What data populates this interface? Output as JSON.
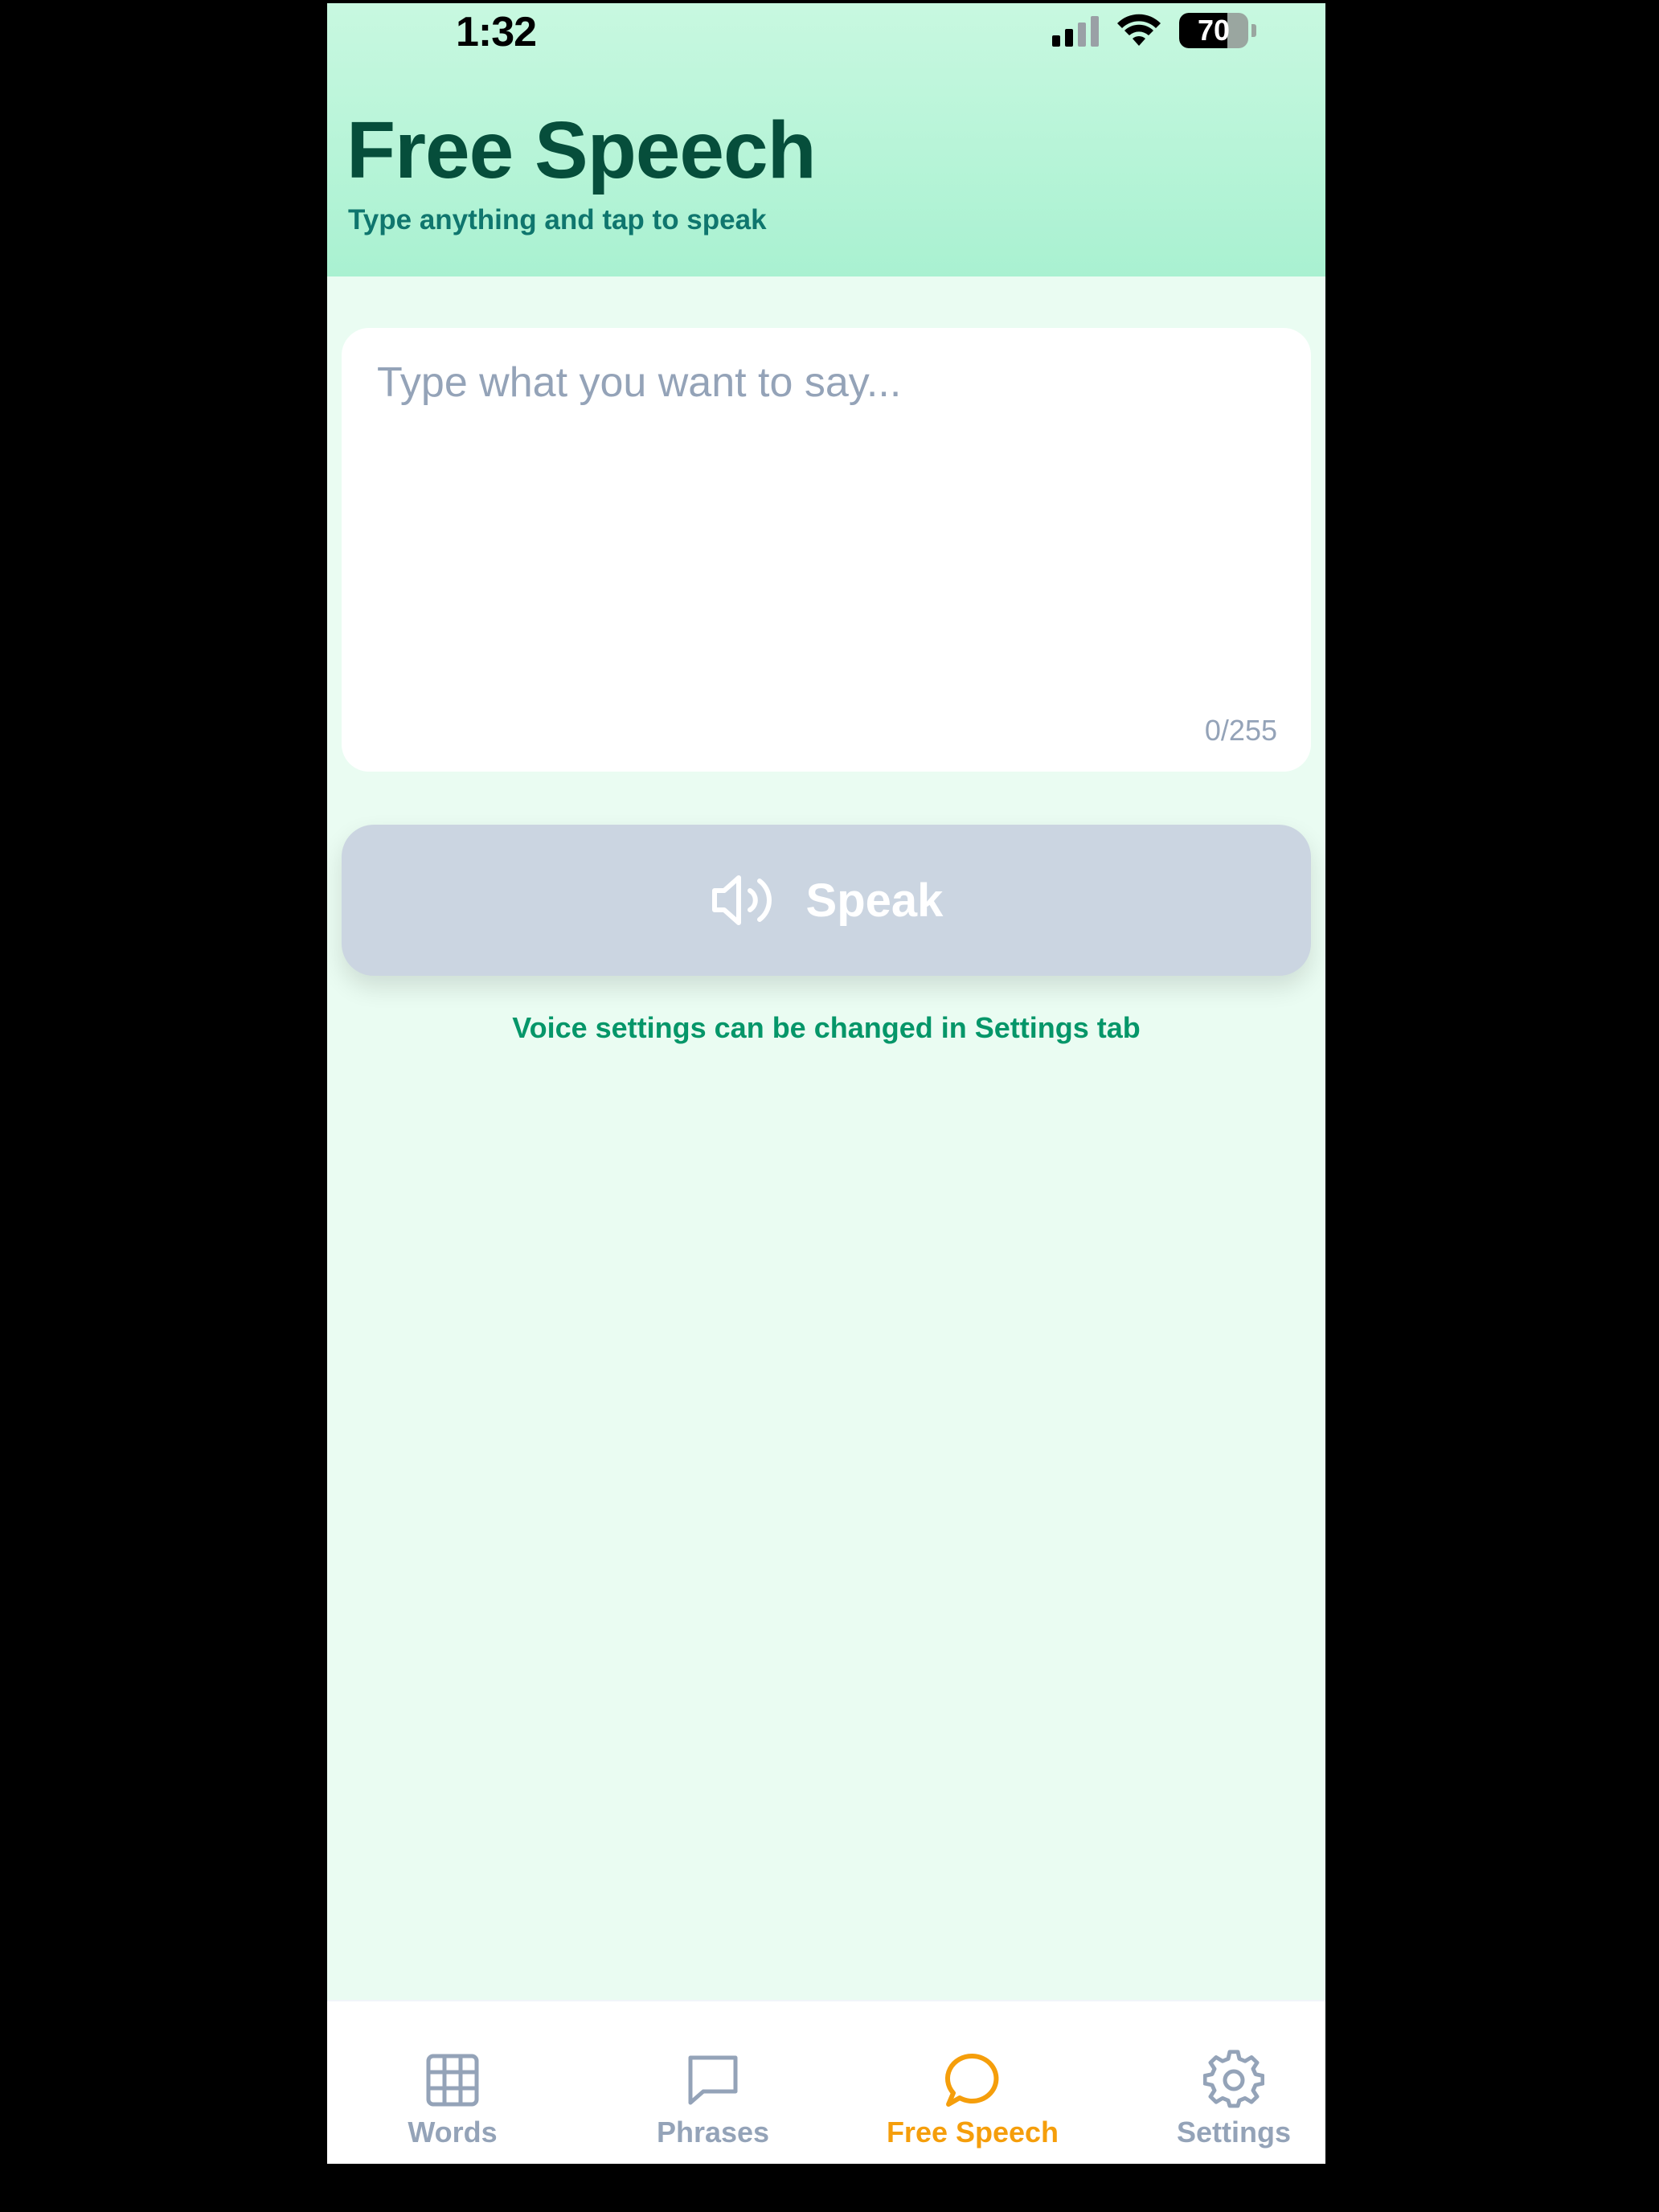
{
  "status_bar": {
    "time": "1:32",
    "battery_level": "70",
    "battery_fraction": 0.7
  },
  "header": {
    "title": "Free Speech",
    "subtitle": "Type anything and tap to speak"
  },
  "input": {
    "placeholder": "Type what you want to say...",
    "value": "",
    "counter": "0/255"
  },
  "speak_button": {
    "label": "Speak",
    "icon": "speaker-icon"
  },
  "hint": "Voice settings can be changed in Settings tab",
  "tabs": [
    {
      "label": "Words",
      "icon": "grid-icon",
      "active": false
    },
    {
      "label": "Phrases",
      "icon": "chat-bubble-icon",
      "active": false
    },
    {
      "label": "Free Speech",
      "icon": "speech-bubble-icon",
      "active": true
    },
    {
      "label": "Settings",
      "icon": "gear-icon",
      "active": false
    }
  ],
  "colors": {
    "title": "#064e3b",
    "subtitle": "#0f766e",
    "background": "#eafcf2",
    "button_disabled": "#cbd5e1",
    "tab_active": "#f59e0b",
    "tab_inactive": "#94a3b8",
    "hint": "#059669"
  }
}
